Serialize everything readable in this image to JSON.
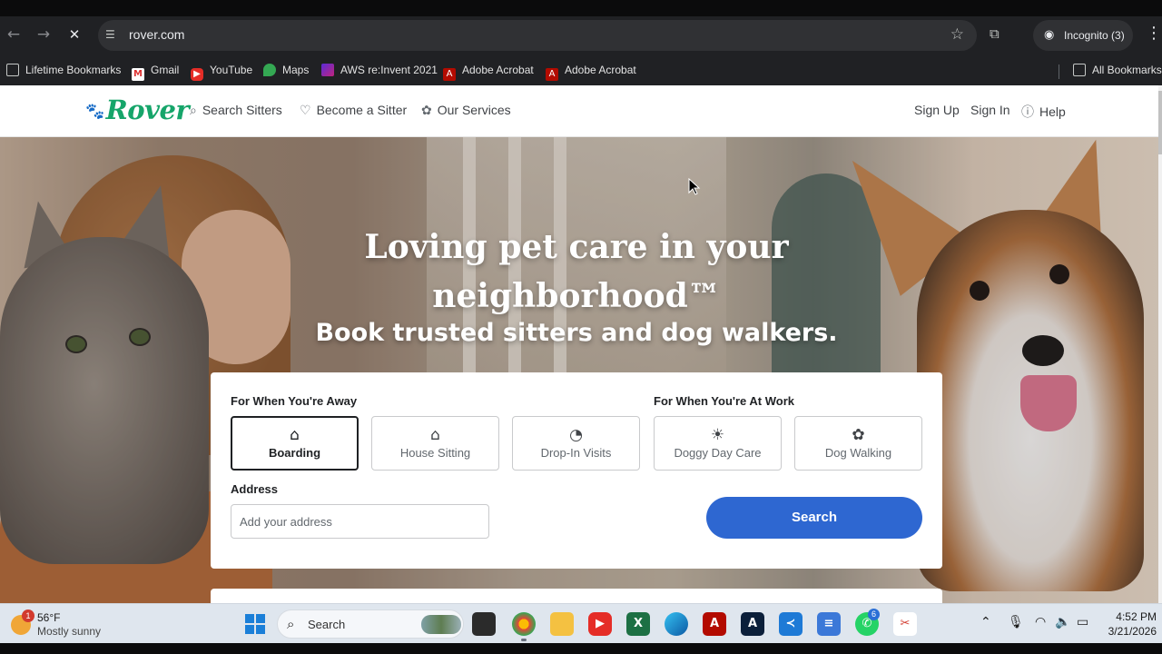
{
  "browser": {
    "url": "rover.com",
    "profile_label": "Incognito (3)",
    "bookmarks": [
      {
        "label": "Lifetime Bookmarks",
        "icon": "bookmark-folder-icon"
      },
      {
        "label": "Gmail",
        "icon": "gmail-icon"
      },
      {
        "label": "YouTube",
        "icon": "youtube-icon"
      },
      {
        "label": "Maps",
        "icon": "maps-icon"
      },
      {
        "label": "AWS re:Invent 2021",
        "icon": "aws-icon"
      },
      {
        "label": "Adobe Acrobat",
        "icon": "adobe-acrobat-icon"
      },
      {
        "label": "Adobe Acrobat",
        "icon": "adobe-acrobat-icon"
      }
    ],
    "all_bookmarks_label": "All Bookmarks"
  },
  "site": {
    "logo_text": "Rover",
    "brand_color": "#16a56a",
    "nav": {
      "search_sitters": "Search Sitters",
      "become_sitter": "Become a Sitter",
      "our_services": "Our Services",
      "sign_up": "Sign Up",
      "sign_in": "Sign In",
      "help": "Help"
    }
  },
  "hero": {
    "headline": "Loving pet care in your neighborhood™",
    "subheadline": "Book trusted sitters and dog walkers."
  },
  "search_card": {
    "away_label": "For When You're Away",
    "work_label": "For When You're At Work",
    "services": [
      {
        "label": "Boarding",
        "icon": "boarding-icon",
        "selected": true
      },
      {
        "label": "House Sitting",
        "icon": "house-sitting-icon",
        "selected": false
      },
      {
        "label": "Drop-In Visits",
        "icon": "drop-in-visits-icon",
        "selected": false
      },
      {
        "label": "Doggy Day Care",
        "icon": "doggy-day-care-icon",
        "selected": false
      },
      {
        "label": "Dog Walking",
        "icon": "dog-walking-icon",
        "selected": false
      }
    ],
    "address_label": "Address",
    "address_placeholder": "Add your address",
    "search_button": "Search",
    "button_color": "#2e67d1"
  },
  "taskbar": {
    "weather_temp": "56°F",
    "weather_condition": "Mostly sunny",
    "weather_badge": "1",
    "search_label": "Search",
    "whatsapp_badge": "6",
    "time": "4:52 PM",
    "date": "3/21/2026"
  }
}
